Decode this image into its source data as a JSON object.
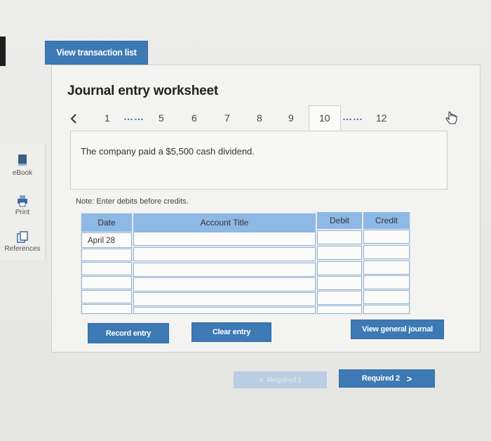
{
  "top_button": {
    "label": "View transaction list"
  },
  "sidebar": {
    "items": [
      {
        "label": "eBook",
        "icon": "ebook-icon"
      },
      {
        "label": "Print",
        "icon": "print-icon"
      },
      {
        "label": "References",
        "icon": "references-icon"
      }
    ]
  },
  "worksheet": {
    "title": "Journal entry worksheet",
    "pager": {
      "prev_icon": "chevron-left-icon",
      "pages": [
        "1",
        "5",
        "6",
        "7",
        "8",
        "9",
        "10",
        "12"
      ],
      "ellipsis": "……",
      "active_page": "10"
    },
    "description": "The company paid a $5,500 cash dividend.",
    "note": "Note: Enter debits before credits.",
    "table": {
      "headers": {
        "date": "Date",
        "account": "Account Title",
        "debit": "Debit",
        "credit": "Credit"
      },
      "rows": [
        {
          "date": "April 28",
          "account": "",
          "debit": "",
          "credit": ""
        },
        {
          "date": "",
          "account": "",
          "debit": "",
          "credit": ""
        },
        {
          "date": "",
          "account": "",
          "debit": "",
          "credit": ""
        },
        {
          "date": "",
          "account": "",
          "debit": "",
          "credit": ""
        },
        {
          "date": "",
          "account": "",
          "debit": "",
          "credit": ""
        },
        {
          "date": "",
          "account": "",
          "debit": "",
          "credit": ""
        }
      ]
    },
    "buttons": {
      "record": "Record entry",
      "clear": "Clear entry",
      "view_journal": "View general journal"
    }
  },
  "footer": {
    "prev_label": "Required 1",
    "next_label": "Required 2"
  },
  "colors": {
    "accent": "#3c79b5",
    "header": "#8eb8e5",
    "disabled": "#b9cde3"
  }
}
